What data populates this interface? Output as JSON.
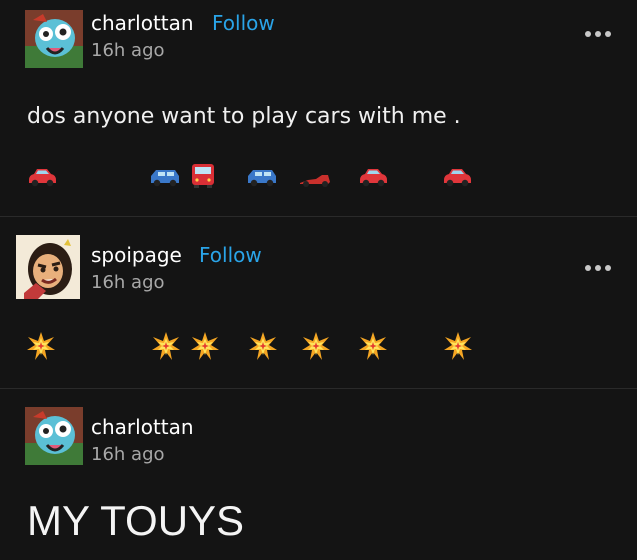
{
  "posts": [
    {
      "username": "charlottan",
      "follow_label": "Follow",
      "time": "16h ago",
      "text": "dos anyone want to play cars with me .",
      "emoji_row": [
        "red-car",
        "blue-suv",
        "red-bus",
        "blue-suv",
        "race-car",
        "red-car",
        "red-car"
      ]
    },
    {
      "username": "spoipage",
      "follow_label": "Follow",
      "time": "16h ago",
      "emoji_row": [
        "collision",
        "collision",
        "collision",
        "collision",
        "collision",
        "collision",
        "collision"
      ]
    },
    {
      "username": "charlottan",
      "time": "16h ago",
      "text": "MY TOUYS"
    }
  ],
  "colors": {
    "background": "#141414",
    "follow": "#2aa4e8",
    "username": "#ffffff",
    "timestamp": "#a8a8a8"
  }
}
